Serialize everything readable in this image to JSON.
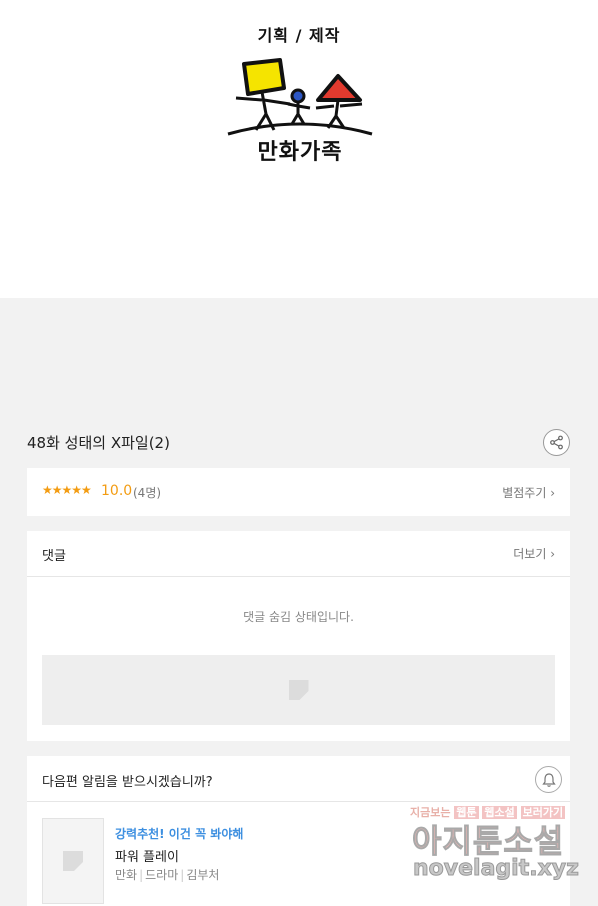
{
  "header": {
    "credit": "기획 / 제작",
    "logo_text": "만화가족"
  },
  "episode": {
    "title": "48화 성태의 X파일(2)"
  },
  "rating": {
    "stars": "★★★★★",
    "score": "10.0",
    "count": "(4명)",
    "rate_link": "별점주기 ›",
    "color": "#f39c12"
  },
  "comments": {
    "label": "댓글",
    "more_link": "더보기 ›",
    "hidden_message": "댓글 숨김 상태입니다."
  },
  "notify": {
    "question": "다음편 알림을 받으시겠습니까?"
  },
  "recommendation": {
    "tag": "강력추천! 이건 꼭 봐야해",
    "title": "파워 플레이",
    "genre": "만화",
    "category": "드라마",
    "author": "김부처",
    "tag_color": "#3d8fe0"
  },
  "watermark": {
    "line1_a": "지금보는",
    "line1_b": "웹툰",
    "line1_c": "웹소설",
    "line1_d": "보러가기",
    "line2": "아지툰소설",
    "line3": "novelagit.xyz"
  }
}
